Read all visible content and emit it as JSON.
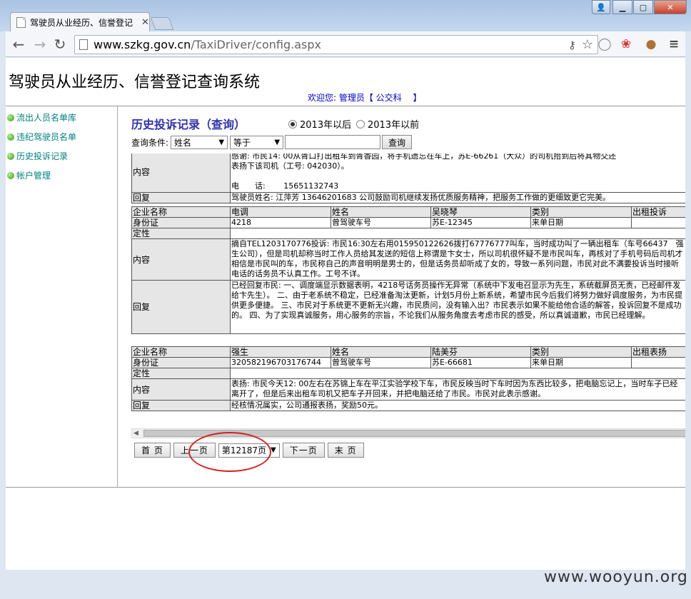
{
  "browser": {
    "tab_title": "驾驶员从业经历、信誉登记",
    "url_host": "www.szkg.gov.cn",
    "url_path": "/TaxiDriver/config.aspx"
  },
  "app": {
    "title": "驾驶员从业经历、信誉登记查询系统",
    "welcome": "欢迎您: 管理员【 公交科　 】"
  },
  "sidebar": {
    "items": [
      {
        "label": "流出人员名单库"
      },
      {
        "label": "违纪驾驶员名单"
      },
      {
        "label": "历史投诉记录"
      },
      {
        "label": "帐户管理"
      }
    ]
  },
  "main": {
    "section_title": "历史投诉记录（查询）",
    "radio_after": "2013年以后",
    "radio_before": "2013年以前",
    "query_label": "查询条件:",
    "field_select": "姓名",
    "op_select": "等于",
    "query_button": "查询"
  },
  "records": [
    {
      "content_lines": [
        "感谢: 市民14: 00从胥口打出租车到胥香园，将手机遗忘在车上，苏E-66261（大众）的司机拾到后将其物交还",
        "表扬下该司机（工号: 042030）。",
        "",
        "电　　话:　　 15651132743"
      ],
      "reply": "驾驶员姓名: 江萍芳 13646201683 公司鼓励司机继续发扬优质服务精神，把服务工作做的更细致更它完美。"
    },
    {
      "company_label": "企业名称",
      "company": "电调",
      "name_label": "姓名",
      "name": "吴晓琴",
      "type_label": "类别",
      "type": "出租投诉",
      "id_label": "身份证",
      "id": "4218",
      "plate_label": "曾驾驶车号",
      "plate": "苏E-12345",
      "date_label": "来单日期",
      "nature_label": "定性",
      "content_label": "内容",
      "reply_label": "回复",
      "content": "摘自TEL1203170776投诉: 市民16:30左右用015950122626拨打67776777叫车，当时成功叫了一辆出租车（车号66437　强生公司），但是司机却称当时工作人员给其发送的短信上称谓是卞女士，所以司机很怀疑不是市民叫车，再核对了手机号码后司机才相信是市民叫的车，市民称自己的声音明明是男士的，但是话务员却听成了女的，导致一系列问题，市民对此不满要投诉当时接听电话的话务员不认真工作。工号不详。",
      "reply": "已经回复市民: 一、调度端显示数据表明，4218号话务员操作无异常（系统中下发电召显示为先生，系统截屏员无责，已经邮件发给卞先生）。 二、由于老系统不稳定，已经准备淘汰更新，计划5月份上新系统，希望市民今后我们将努力做好调度服务，为市民提供更多便捷。 三、市民对于系统更不更新无兴趣，市民质问，没有输入出？市民表示如果不能给他合适的解答，投诉回复不是成功的。 四、为了实现真诚服务，用心服务的宗旨，不论我们从服务角度去考虑市民的感受，所以真诚道歉，市民已经理解。"
    },
    {
      "company_label": "企业名称",
      "company": "强生",
      "name_label": "姓名",
      "name": "陆美芬",
      "type_label": "类别",
      "type": "出租表扬",
      "id_label": "身份证",
      "id": "320582196703176744",
      "plate_label": "曾驾驶车号",
      "plate": "苏E-66681",
      "date_label": "来单日期",
      "nature_label": "定性",
      "content_label": "内容",
      "reply_label": "回复",
      "content": "表扬: 市民今天12: 00左右在苏锦上车在平江实验学校下车，市民反映当时下车时因为东西比较多，把电脑忘记上，当时车子已经离开了，但是后来出租车司机又把车子开回来，并把电脑还给了市民。市民对此表示感谢。",
      "reply": "经核情况属实，公司通报表扬，奖励50元。"
    }
  ],
  "pager": {
    "first": "首 页",
    "prev": "上一页",
    "current": "第12187页",
    "next": "下一页",
    "last": "末 页"
  },
  "watermark": "www.wooyun.org",
  "colors": {
    "sidebar_link": "#008080",
    "section_title": "#3030b0",
    "welcome": "#0000cc",
    "annotation": "#d62020"
  }
}
